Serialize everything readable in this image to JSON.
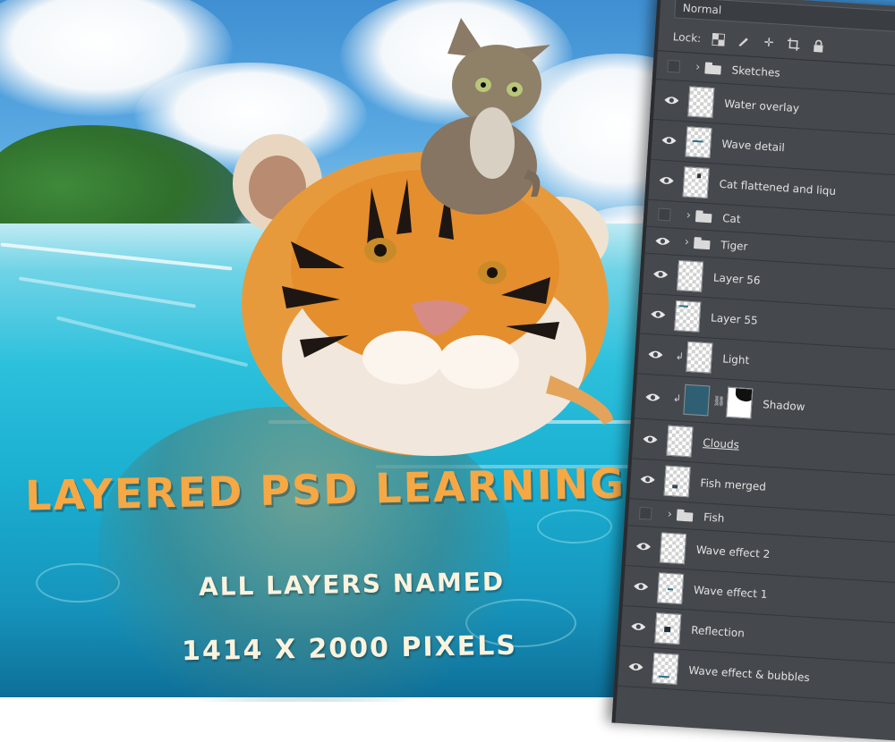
{
  "promo": {
    "headline": "LAYERED PSD LEARNING FILE",
    "subline1": "ALL LAYERS NAMED",
    "subline2": "1414 X 2000 PIXELS",
    "accent_color": "#f6a844",
    "subtext_color": "#fbf3de"
  },
  "layers_panel": {
    "blend_mode": "Normal",
    "lock_label": "Lock:",
    "lock_icons": [
      "lock-transparent-pixels-icon",
      "lock-image-pixels-icon",
      "lock-position-icon",
      "lock-artboard-icon",
      "lock-all-icon"
    ],
    "layers": [
      {
        "name": "Sketches",
        "type": "group",
        "visible": false
      },
      {
        "name": "Water overlay",
        "type": "layer",
        "visible": true
      },
      {
        "name": "Wave detail",
        "type": "layer",
        "visible": true
      },
      {
        "name": "Cat flattened and liqu",
        "type": "layer",
        "visible": true
      },
      {
        "name": "Cat",
        "type": "group",
        "visible": false
      },
      {
        "name": "Tiger",
        "type": "group",
        "visible": true
      },
      {
        "name": "Layer 56",
        "type": "layer",
        "visible": true
      },
      {
        "name": "Layer 55",
        "type": "layer",
        "visible": true
      },
      {
        "name": "Light",
        "type": "layer",
        "visible": true,
        "clipped": true
      },
      {
        "name": "Shadow",
        "type": "layer",
        "visible": true,
        "clipped": true,
        "has_mask": true
      },
      {
        "name": "Clouds",
        "type": "layer",
        "visible": true,
        "underlined": true
      },
      {
        "name": "Fish merged",
        "type": "layer",
        "visible": true
      },
      {
        "name": "Fish",
        "type": "group",
        "visible": false
      },
      {
        "name": "Wave effect 2",
        "type": "layer",
        "visible": true
      },
      {
        "name": "Wave effect 1",
        "type": "layer",
        "visible": true
      },
      {
        "name": "Reflection",
        "type": "layer",
        "visible": true
      },
      {
        "name": "Wave effect & bubbles",
        "type": "layer",
        "visible": true
      }
    ]
  }
}
